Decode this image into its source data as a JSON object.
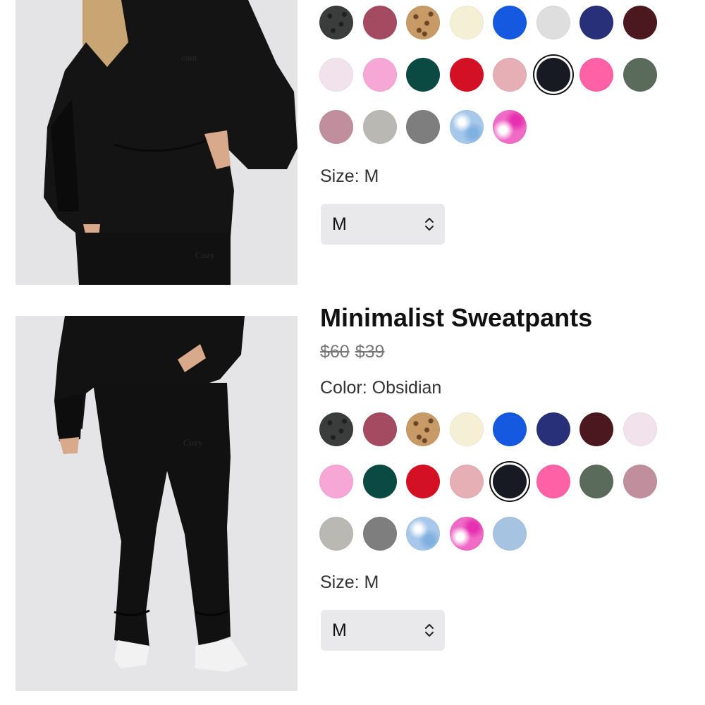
{
  "products": [
    {
      "size_label": "Size: M",
      "size_value": "M",
      "selected_color": "obsidian",
      "swatches": [
        {
          "name": "leopard-dark",
          "color": "#3a3d3c",
          "pattern": "dark-leopard"
        },
        {
          "name": "berry",
          "color": "#a44b62"
        },
        {
          "name": "leopard",
          "color": "#c79a66",
          "pattern": "leopard"
        },
        {
          "name": "cream",
          "color": "#f5efd6"
        },
        {
          "name": "royal-blue",
          "color": "#1559e0"
        },
        {
          "name": "heather-grey",
          "color": "#dedede"
        },
        {
          "name": "navy",
          "color": "#283079"
        },
        {
          "name": "burgundy",
          "color": "#4b1820"
        },
        {
          "name": "light-pink",
          "color": "#f1e2ec"
        },
        {
          "name": "bubblegum",
          "color": "#f7a7d5"
        },
        {
          "name": "forest",
          "color": "#0a4a42"
        },
        {
          "name": "red",
          "color": "#d41124"
        },
        {
          "name": "dusty-pink",
          "color": "#e6aeb5"
        },
        {
          "name": "obsidian",
          "color": "#181a23"
        },
        {
          "name": "hot-pink",
          "color": "#ff61a6"
        },
        {
          "name": "sage",
          "color": "#5b6b5b"
        },
        {
          "name": "mauve",
          "color": "#c08e9d"
        },
        {
          "name": "stone",
          "color": "#bab8b3"
        },
        {
          "name": "charcoal",
          "color": "#7e7e7e"
        },
        {
          "name": "sky-tie-dye",
          "color": "#a7c8ea",
          "pattern": "blue-dye"
        },
        {
          "name": "pink-tie-dye",
          "color": "#ef6bc5",
          "pattern": "pink-dye"
        }
      ]
    },
    {
      "title": "Minimalist Sweatpants",
      "price_original": "$60",
      "price_sale": "$39",
      "color_label": "Color: Obsidian",
      "size_label": "Size: M",
      "size_value": "M",
      "selected_color": "obsidian",
      "swatches": [
        {
          "name": "leopard-dark",
          "color": "#3a3d3c",
          "pattern": "dark-leopard"
        },
        {
          "name": "berry",
          "color": "#a44b62"
        },
        {
          "name": "leopard",
          "color": "#c79a66",
          "pattern": "leopard"
        },
        {
          "name": "cream",
          "color": "#f5efd6"
        },
        {
          "name": "royal-blue",
          "color": "#1559e0"
        },
        {
          "name": "navy",
          "color": "#283079"
        },
        {
          "name": "burgundy",
          "color": "#4b1820"
        },
        {
          "name": "light-pink",
          "color": "#f1e2ec"
        },
        {
          "name": "bubblegum",
          "color": "#f7a7d5"
        },
        {
          "name": "forest",
          "color": "#0a4a42"
        },
        {
          "name": "red",
          "color": "#d41124"
        },
        {
          "name": "dusty-pink",
          "color": "#e6aeb5"
        },
        {
          "name": "obsidian",
          "color": "#181a23"
        },
        {
          "name": "hot-pink",
          "color": "#ff61a6"
        },
        {
          "name": "sage",
          "color": "#5b6b5b"
        },
        {
          "name": "mauve",
          "color": "#c08e9d"
        },
        {
          "name": "stone",
          "color": "#bab8b3"
        },
        {
          "name": "charcoal",
          "color": "#7e7e7e"
        },
        {
          "name": "sky-tie-dye",
          "color": "#a7c8ea",
          "pattern": "blue-dye"
        },
        {
          "name": "pink-tie-dye",
          "color": "#ef6bc5",
          "pattern": "pink-dye"
        },
        {
          "name": "light-blue",
          "color": "#a6c4e2"
        }
      ]
    }
  ]
}
